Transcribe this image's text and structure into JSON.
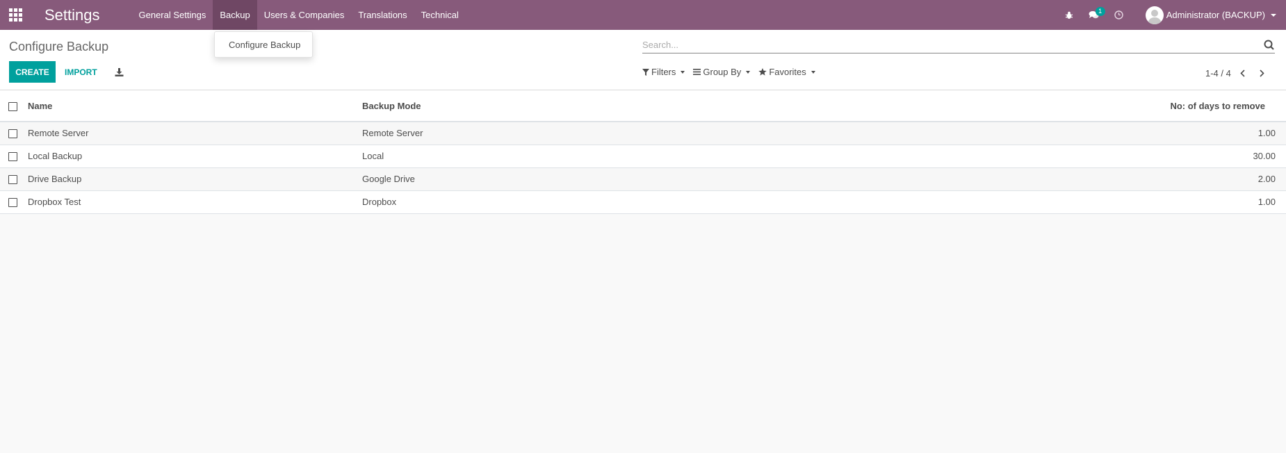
{
  "navbar": {
    "brand": "Settings",
    "menu": [
      {
        "label": "General Settings"
      },
      {
        "label": "Backup"
      },
      {
        "label": "Users & Companies"
      },
      {
        "label": "Translations"
      },
      {
        "label": "Technical"
      }
    ],
    "messages_badge": "1",
    "user_label": "Administrator (BACKUP)"
  },
  "dropdown": {
    "items": [
      {
        "label": "Configure Backup"
      }
    ]
  },
  "control_panel": {
    "breadcrumb": "Configure Backup",
    "create_label": "CREATE",
    "import_label": "IMPORT",
    "search_placeholder": "Search...",
    "filters_label": "Filters",
    "groupby_label": "Group By",
    "favorites_label": "Favorites",
    "pager": "1-4 / 4"
  },
  "table": {
    "columns": {
      "name": "Name",
      "mode": "Backup Mode",
      "days": "No: of days to remove"
    },
    "rows": [
      {
        "name": "Remote Server",
        "mode": "Remote Server",
        "days": "1.00"
      },
      {
        "name": "Local Backup",
        "mode": "Local",
        "days": "30.00"
      },
      {
        "name": "Drive Backup",
        "mode": "Google Drive",
        "days": "2.00"
      },
      {
        "name": "Dropbox Test",
        "mode": "Dropbox",
        "days": "1.00"
      }
    ]
  },
  "colors": {
    "navbar": "#875a7b",
    "accent": "#00a09d"
  },
  "icons": [
    "apps-grid-icon",
    "bug-icon",
    "chat-icon",
    "clock-icon",
    "download-icon",
    "search-icon",
    "filter-icon",
    "list-icon",
    "star-icon",
    "chevron-left-icon",
    "chevron-right-icon"
  ]
}
